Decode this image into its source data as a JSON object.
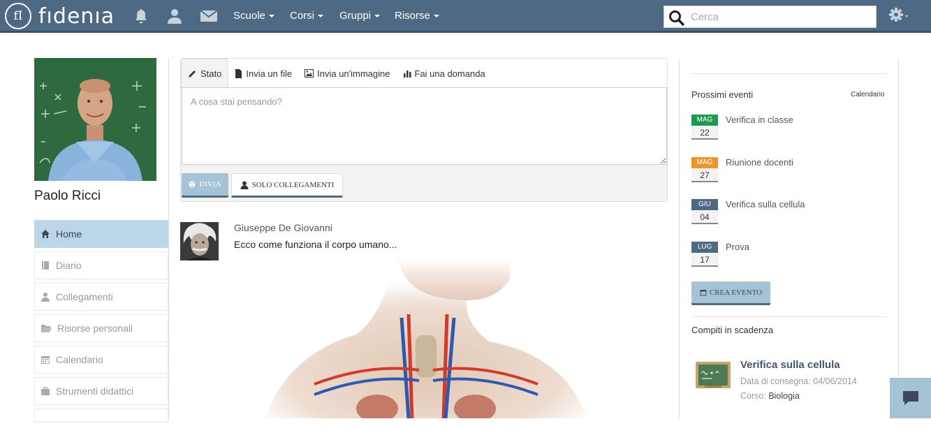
{
  "brand": {
    "logo_mark": "fI",
    "logo_text": "fıdenıa"
  },
  "nav": {
    "icons": [
      "bell-icon",
      "user-icon",
      "envelope-icon"
    ],
    "menus": [
      "Scuole",
      "Corsi",
      "Gruppi",
      "Risorse"
    ],
    "search_placeholder": "Cerca"
  },
  "profile": {
    "name": "Paolo Ricci"
  },
  "sidebar": {
    "items": [
      {
        "label": "Home",
        "icon": "home-icon",
        "active": true
      },
      {
        "label": "Diario",
        "icon": "book-icon"
      },
      {
        "label": "Collegamenti",
        "icon": "user-icon"
      },
      {
        "label": "Risorse personali",
        "icon": "folder-open-icon"
      },
      {
        "label": "Calendario",
        "icon": "calendar-icon"
      },
      {
        "label": "Strumenti didattici",
        "icon": "briefcase-icon"
      }
    ]
  },
  "composer": {
    "tabs": [
      {
        "label": "Stato",
        "icon": "pencil-icon",
        "active": true
      },
      {
        "label": "Invia un file",
        "icon": "file-icon"
      },
      {
        "label": "Invia un'immagine",
        "icon": "image-icon"
      },
      {
        "label": "Fai una domanda",
        "icon": "bar-chart-icon"
      }
    ],
    "placeholder": "A cosa stai pensando?",
    "send_label": "INVIA",
    "audience_label": "SOLO COLLEGAMENTI"
  },
  "post": {
    "author": "Giuseppe De Giovanni",
    "text": "Ecco come funziona il corpo umano..."
  },
  "events": {
    "title": "Prossimi eventi",
    "calendar_link": "Calendario",
    "items": [
      {
        "month": "MAG",
        "day": "22",
        "title": "Verifica in classe",
        "color": "#1e9a4f"
      },
      {
        "month": "MAG",
        "day": "27",
        "title": "Riunione docenti",
        "color": "#f0932b"
      },
      {
        "month": "GIU",
        "day": "04",
        "title": "Verifica sulla cellula",
        "color": "#4e6983"
      },
      {
        "month": "LUG",
        "day": "17",
        "title": "Prova",
        "color": "#4e6983"
      }
    ],
    "create_label": "CREA EVENTO"
  },
  "tasks": {
    "title": "Compiti in scadenza",
    "item": {
      "title": "Verifica sulla cellula",
      "due_label": "Data di consegna:",
      "due_date": "04/06/2014",
      "course_label": "Corso:",
      "course": "Biologia"
    }
  }
}
